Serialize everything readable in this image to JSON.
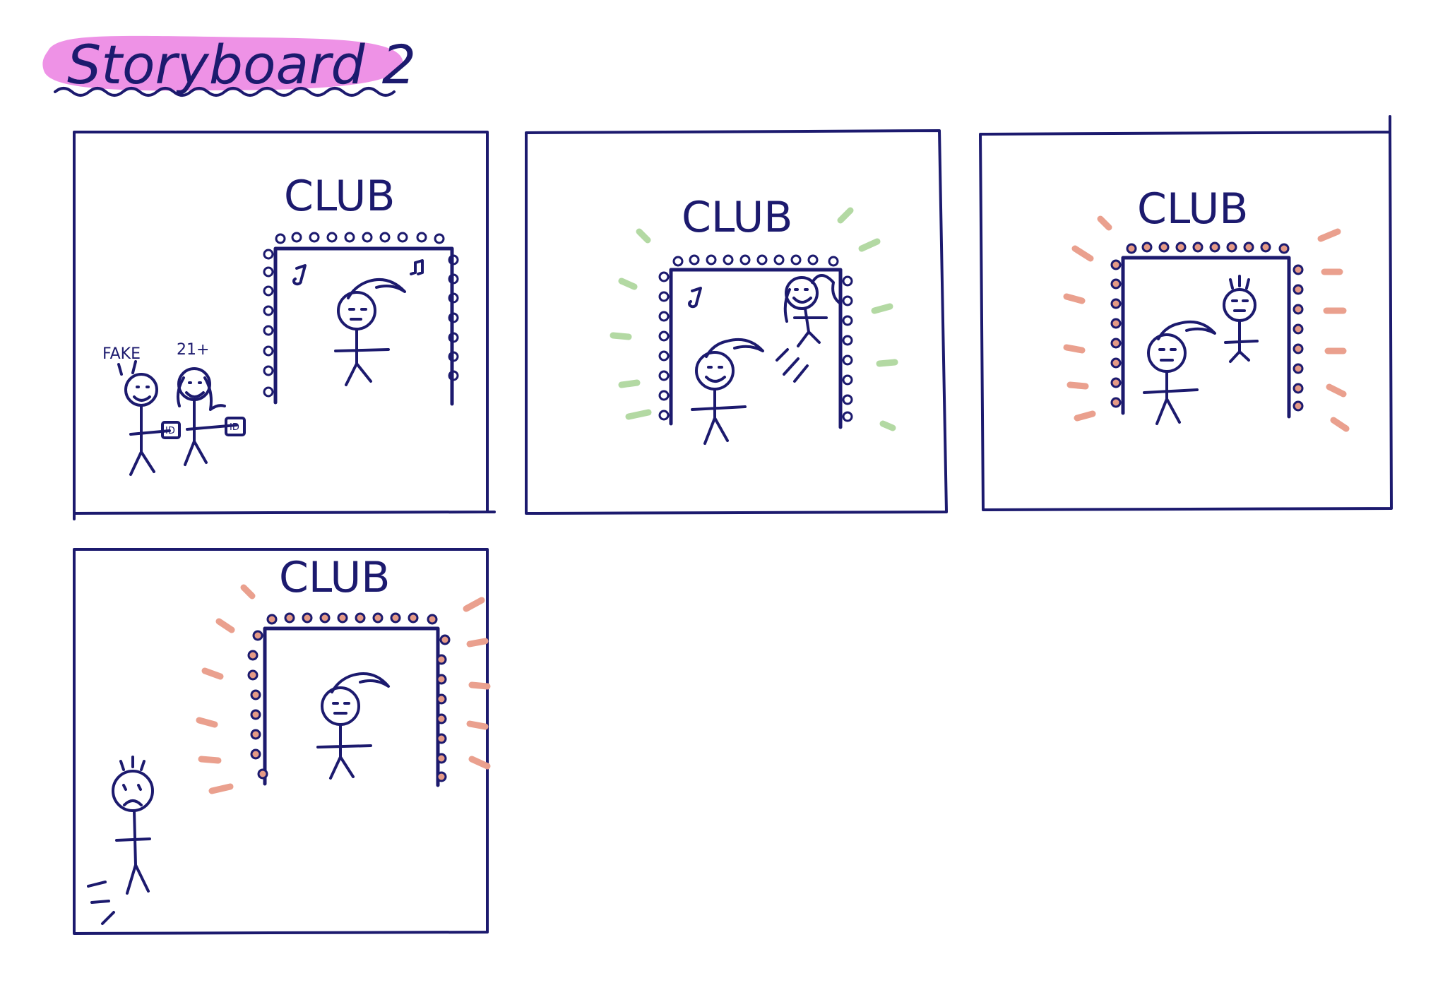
{
  "title": "Storyboard 2",
  "colors": {
    "ink": "#1c1a6e",
    "title_highlight": "#ee92e6",
    "glow_happy": "#b3d9a3",
    "glow_tense": "#eaa08e",
    "bulbs_tense": "#e59a86"
  },
  "panels": [
    {
      "sign": "CLUB",
      "labels": [
        "FAKE",
        "21+",
        "ID",
        "ID"
      ],
      "mood": "neutral"
    },
    {
      "sign": "CLUB",
      "labels": [],
      "mood": "happy"
    },
    {
      "sign": "CLUB",
      "labels": [],
      "mood": "tense"
    },
    {
      "sign": "CLUB",
      "labels": [],
      "mood": "sad"
    }
  ]
}
